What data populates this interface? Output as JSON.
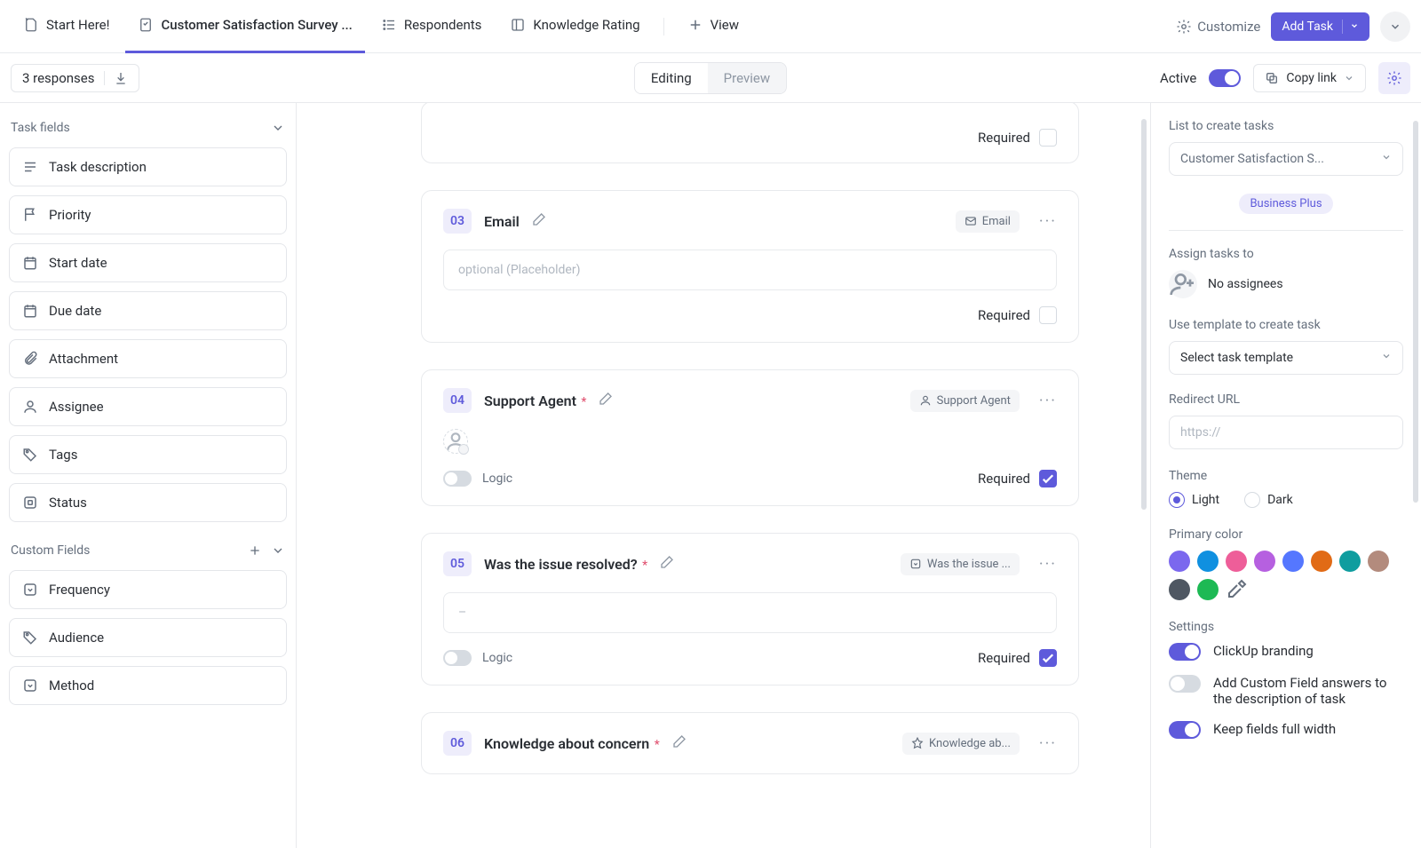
{
  "tabs": {
    "start": "Start Here!",
    "active": "Customer Satisfaction Survey ...",
    "respondents": "Respondents",
    "knowledge": "Knowledge Rating",
    "view": "View"
  },
  "topbar": {
    "customize": "Customize",
    "add_task": "Add Task"
  },
  "subbar": {
    "responses": "3 responses",
    "editing": "Editing",
    "preview": "Preview",
    "active": "Active",
    "copy": "Copy link"
  },
  "left": {
    "task_fields": "Task fields",
    "items": [
      "Task description",
      "Priority",
      "Start date",
      "Due date",
      "Attachment",
      "Assignee",
      "Tags",
      "Status"
    ],
    "custom_fields": "Custom Fields",
    "custom_items": [
      "Frequency",
      "Audience",
      "Method"
    ]
  },
  "cards": {
    "required": "Required",
    "logic": "Logic",
    "placeholder": "optional (Placeholder)",
    "dash": "–",
    "q3": {
      "num": "03",
      "title": "Email",
      "chip": "Email"
    },
    "q4": {
      "num": "04",
      "title": "Support Agent",
      "chip": "Support Agent"
    },
    "q5": {
      "num": "05",
      "title": "Was the issue resolved?",
      "chip": "Was the issue ..."
    },
    "q6": {
      "num": "06",
      "title": "Knowledge about concern",
      "chip": "Knowledge ab..."
    }
  },
  "right": {
    "list_label": "List to create tasks",
    "list_value": "Customer Satisfaction S...",
    "plan": "Business Plus",
    "assign_label": "Assign tasks to",
    "no_assignees": "No assignees",
    "template_label": "Use template to create task",
    "template_value": "Select task template",
    "redirect_label": "Redirect URL",
    "redirect_ph": "https://",
    "theme_label": "Theme",
    "light": "Light",
    "dark": "Dark",
    "primary_label": "Primary color",
    "colors": [
      "#7b68ee",
      "#1090e0",
      "#ee5e99",
      "#b660e0",
      "#5577ff",
      "#e16b16",
      "#0f9d9f",
      "#b38b7d",
      "#4f5762",
      "#1db954"
    ],
    "settings_label": "Settings",
    "s1": "ClickUp branding",
    "s2": "Add Custom Field answers to the description of task",
    "s3": "Keep fields full width"
  }
}
